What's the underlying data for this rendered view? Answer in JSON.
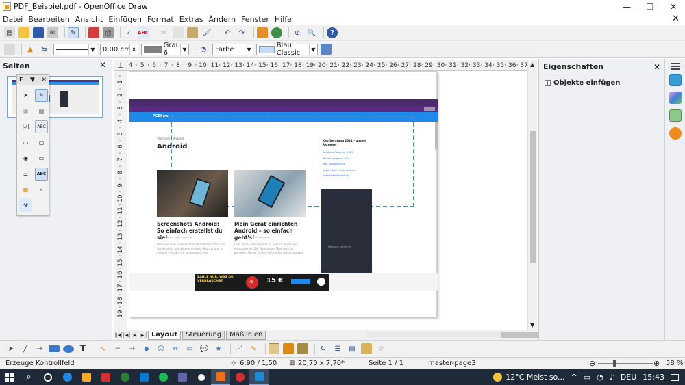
{
  "window": {
    "title": "PDF_Beispiel.pdf - OpenOffice Draw",
    "minimize": "—",
    "maximize": "❐",
    "close": "✕",
    "close_doc": "✕"
  },
  "menu": [
    "Datei",
    "Bearbeiten",
    "Ansicht",
    "Einfügen",
    "Format",
    "Extras",
    "Ändern",
    "Fenster",
    "Hilfe"
  ],
  "line_toolbar": {
    "width_value": "0,00 cm",
    "line_color": "Grau 6",
    "area_style": "Farbe",
    "area_color": "Blau Classic",
    "line_color_swatch": "#808080",
    "area_color_swatch": "#c6dcf5"
  },
  "pages_panel": {
    "title": "Seiten",
    "close": "✕",
    "slide_number": "1",
    "float_title": "F"
  },
  "ruler": {
    "h_ticks": [
      "4",
      "·",
      "5",
      "·",
      "6",
      "·",
      "7",
      "·",
      "8",
      "·",
      "9",
      "·",
      "10",
      "·",
      "11",
      "·",
      "12",
      "·",
      "13",
      "·",
      "14",
      "·",
      "15",
      "·",
      "16",
      "·",
      "17",
      "·",
      "18",
      "·",
      "19",
      "·",
      "20",
      "·",
      "21",
      "·",
      "22",
      "·",
      "23",
      "·",
      "24",
      "·",
      "25",
      "·",
      "26",
      "·",
      "27",
      "·",
      "28",
      "·",
      "29",
      "·",
      "30",
      "·",
      "31",
      "·",
      "32",
      "·",
      "33",
      "·",
      "34",
      "·",
      "35",
      "·",
      "36",
      "·",
      "37"
    ],
    "v_ticks": [
      "·",
      "1",
      "·",
      "2",
      "·",
      "3",
      "·",
      "4",
      "·",
      "5",
      "·",
      "6",
      "·",
      "7",
      "·",
      "8",
      "·",
      "9",
      "·",
      "10",
      "·",
      "11",
      "·",
      "12",
      "·",
      "13",
      "·",
      "14",
      "·",
      "15",
      "·",
      "16",
      "·",
      "17",
      "·",
      "18",
      "·",
      "19"
    ]
  },
  "embedded_page": {
    "site_name": "PCShow",
    "breadcrumb": "Startseite › Android",
    "heading": "Android",
    "sidebar_title": "Kaufberatung 2021 – unsere Ratgeber",
    "sidebar_links": [
      "Windows-Ratgeber 2021",
      "iPhone-Vergleich 2021",
      "Mac-Kaufberatung",
      "Apple Watch Unterschiede",
      "AirPods Kaufberatung"
    ],
    "card1_title": "Screenshots Android: So einfach erstellst du sie!",
    "card1_meta": "20 Kommentare · 4 Min Lesedauer",
    "card1_text": "Gleichen einen kleinen Bildschirmbereich bis zum Screenshots auf deinem Android-Smartphone so einfach – erkläre ich in diesem Artikel",
    "card2_title": "Mein Gerät einrichten Android – so einfach geht's!",
    "card2_meta": "27 Kommentare · 5 Min Lesedauer",
    "card2_text": "Dein neues Smartphone ist endlich bereit und einsatzbereit. Die Wichtigsten Überblick zu beheben. Dieser Artikel hilft dir bei dieser Aufgabe",
    "dark_box_text": "Werbung entfernen",
    "ad_line1": "ZAHLE NUR, WAS DU",
    "ad_line2": "VERBRAUCHST",
    "ad_price": "15 €",
    "ad_badge": "AB"
  },
  "sheet_tabs": [
    "Layout",
    "Steuerung",
    "Maßlinien"
  ],
  "properties_panel": {
    "title": "Eigenschaften",
    "close": "✕",
    "section": "Objekte einfügen",
    "expand": "+"
  },
  "status": {
    "message": "Erzeuge Kontrollfeld",
    "position": "6,90 / 1,50",
    "size": "20,70 x 7,70",
    "modified": "*",
    "page": "Seite 1 / 1",
    "master": "master-page3",
    "zoom": "58 %",
    "zoom_minus": "⊖",
    "zoom_plus": "⊕"
  },
  "taskbar": {
    "weather": "12°C  Meist so...",
    "language": "DEU",
    "time": "15:43",
    "tray_icons": "^",
    "app_colors": [
      "#1e88e5",
      "#f9a825",
      "#d32f2f",
      "#2e7d32",
      "#0078d4",
      "#1db954",
      "#6264a7",
      "#ffffff",
      "#e8711a",
      "#d32f2f",
      "#1d8bd3"
    ]
  }
}
